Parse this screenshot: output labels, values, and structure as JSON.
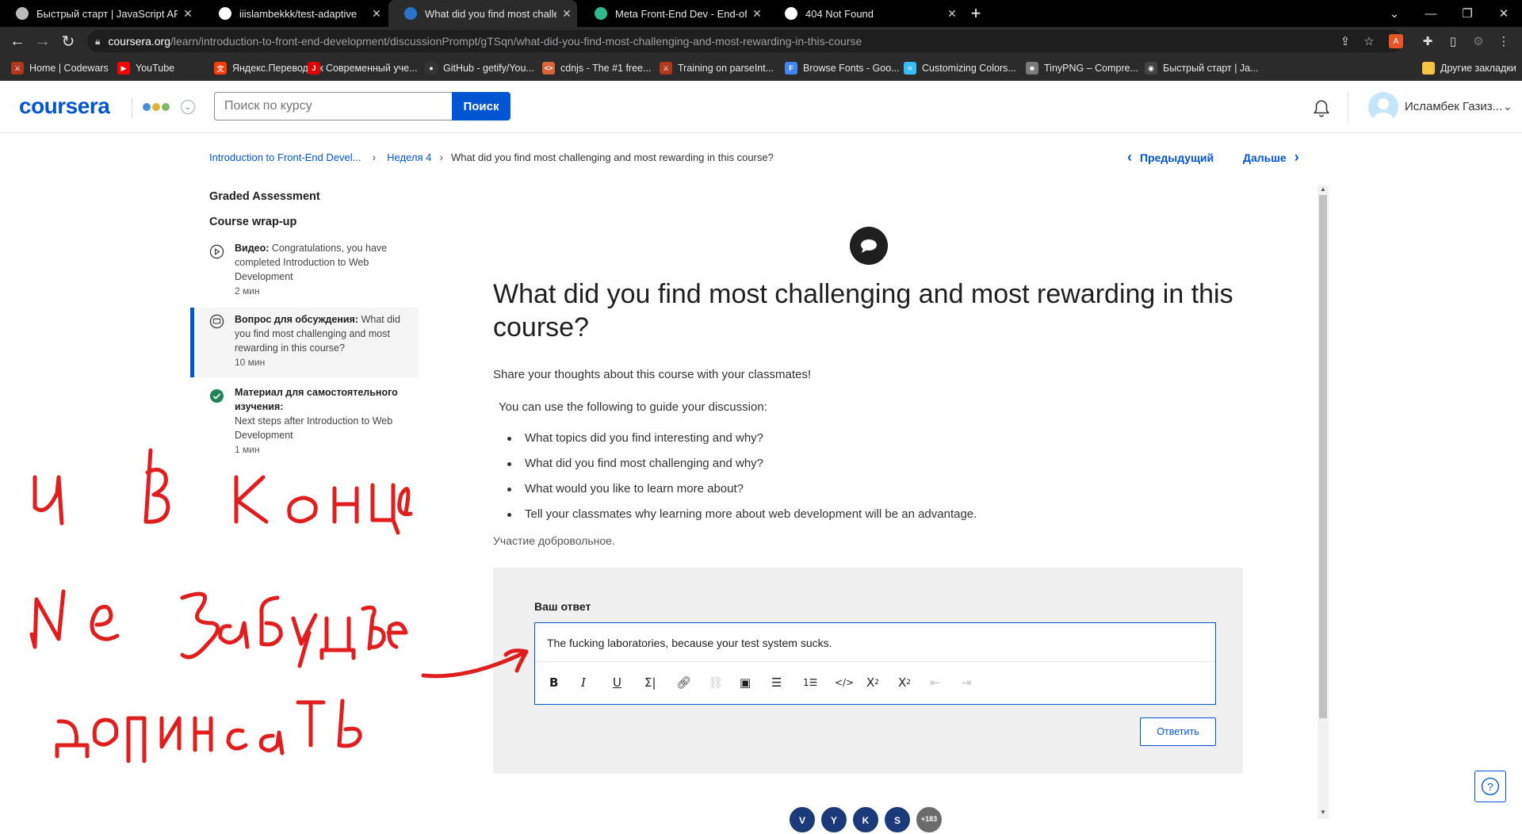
{
  "browser": {
    "tabs": [
      {
        "title": "Быстрый старт | JavaScript API 2",
        "icon": "yandex-maps-icon",
        "active": false
      },
      {
        "title": "iiislambekkk/test-adaptive",
        "icon": "github-icon",
        "active": false
      },
      {
        "title": "What did you find most challeng",
        "icon": "coursera-icon",
        "active": true
      },
      {
        "title": "Meta Front-End Dev - End-of-Co",
        "icon": "quizlet-icon",
        "active": false
      },
      {
        "title": "404 Not Found",
        "icon": "webstorm-icon",
        "active": false
      }
    ],
    "url_host": "coursera.org",
    "url_path": "/learn/introduction-to-front-end-development/discussionPrompt/gTSqn/what-did-you-find-most-challenging-and-most-rewarding-in-this-course",
    "bookmarks": [
      {
        "label": "Home | Codewars",
        "color": "#b1361e",
        "glyph": "⚔"
      },
      {
        "label": "YouTube",
        "color": "#ff0000",
        "glyph": "▶"
      },
      {
        "label": "Яндекс.Переводчик",
        "color": "#ff3d00",
        "glyph": "文"
      },
      {
        "label": "Современный уче...",
        "color": "#e00000",
        "glyph": "J"
      },
      {
        "label": "GitHub - getify/You...",
        "color": "#333333",
        "glyph": "●"
      },
      {
        "label": "cdnjs - The #1 free...",
        "color": "#d9643a",
        "glyph": "<>"
      },
      {
        "label": "Training on parseInt...",
        "color": "#b1361e",
        "glyph": "⚔"
      },
      {
        "label": "Browse Fonts - Goo...",
        "color": "#4285f4",
        "glyph": "F"
      },
      {
        "label": "Customizing Colors...",
        "color": "#38bdf8",
        "glyph": "≈"
      },
      {
        "label": "TinyPNG – Compre...",
        "color": "#7a7a7a",
        "glyph": "☻"
      },
      {
        "label": "Быстрый старт | Ja...",
        "color": "#444444",
        "glyph": "◉"
      }
    ],
    "other_bookmarks": "Другие закладки"
  },
  "header": {
    "logo": "coursera",
    "search_placeholder": "Поиск по курсу",
    "search_button": "Поиск",
    "user_name": "Исламбек Газиз..."
  },
  "breadcrumb": {
    "course": "Introduction to Front-End Devel...",
    "week": "Неделя 4",
    "current": "What did you find most challenging and most rewarding in this course?",
    "prev": "Предыдущий",
    "next": "Дальше"
  },
  "sidebar": {
    "section1": "Graded Assessment",
    "section2": "Course wrap-up",
    "items": [
      {
        "type": "Видео:",
        "title": "Congratulations, you have completed Introduction to Web Development",
        "duration": "2 мин",
        "status": "video",
        "active": false
      },
      {
        "type": "Вопрос для обсуждения:",
        "title": "What did you find most challenging and most rewarding in this course?",
        "duration": "10 мин",
        "status": "discussion",
        "active": true
      },
      {
        "type": "Материал для самостоятельного изучения:",
        "title": "Next steps after Introduction to Web Development",
        "duration": "1 мин",
        "status": "completed",
        "active": false
      }
    ]
  },
  "main": {
    "title": "What did you find most challenging and most rewarding in this course?",
    "intro": "Share your thoughts about this course with your classmates!",
    "guide": "You can use the following to guide your discussion:",
    "bullets": [
      "What topics did you find interesting and why?",
      "What did you find most challenging and why?",
      "What would you like to learn more about?",
      "Tell your classmates why learning more about web development will be an advantage."
    ],
    "voluntary": "Участие добровольное.",
    "answer_label": "Ваш ответ",
    "answer_text": "The fucking laboratories, because  your test system  sucks.",
    "reply_button": "Ответить",
    "participants": [
      {
        "initial": "V",
        "color": "#1b3a7a"
      },
      {
        "initial": "Y",
        "color": "#1b3a7a"
      },
      {
        "initial": "K",
        "color": "#1b3a7a"
      },
      {
        "initial": "S",
        "color": "#1b3a7a"
      },
      {
        "initial": "+183",
        "color": "#6b6b6b"
      }
    ]
  },
  "colors": {
    "accent": "#0056d2",
    "annotation": "#e01e1e",
    "completed": "#1f8354"
  }
}
